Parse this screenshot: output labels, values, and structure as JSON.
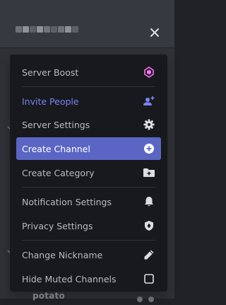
{
  "colors": {
    "menu_bg": "#18191c",
    "active_bg": "#5b66c4",
    "invite_color": "#7983f5",
    "boost_pink": "#ff73fa",
    "text": "#b9bbbe"
  },
  "header": {
    "server_name_obscured": true,
    "close_icon": "close-icon"
  },
  "background": {
    "channel_name": "potato"
  },
  "menu": {
    "items": [
      {
        "label": "Server Boost",
        "icon": "boost-gem-icon"
      },
      {
        "label": "Invite People",
        "icon": "add-person-icon"
      },
      {
        "label": "Server Settings",
        "icon": "gear-icon"
      },
      {
        "label": "Create Channel",
        "icon": "plus-circle-icon",
        "active": true
      },
      {
        "label": "Create Category",
        "icon": "folder-plus-icon"
      },
      {
        "label": "Notification Settings",
        "icon": "bell-icon"
      },
      {
        "label": "Privacy Settings",
        "icon": "shield-icon"
      },
      {
        "label": "Change Nickname",
        "icon": "pencil-icon"
      },
      {
        "label": "Hide Muted Channels",
        "icon": "checkbox-icon",
        "checked": false
      }
    ]
  }
}
